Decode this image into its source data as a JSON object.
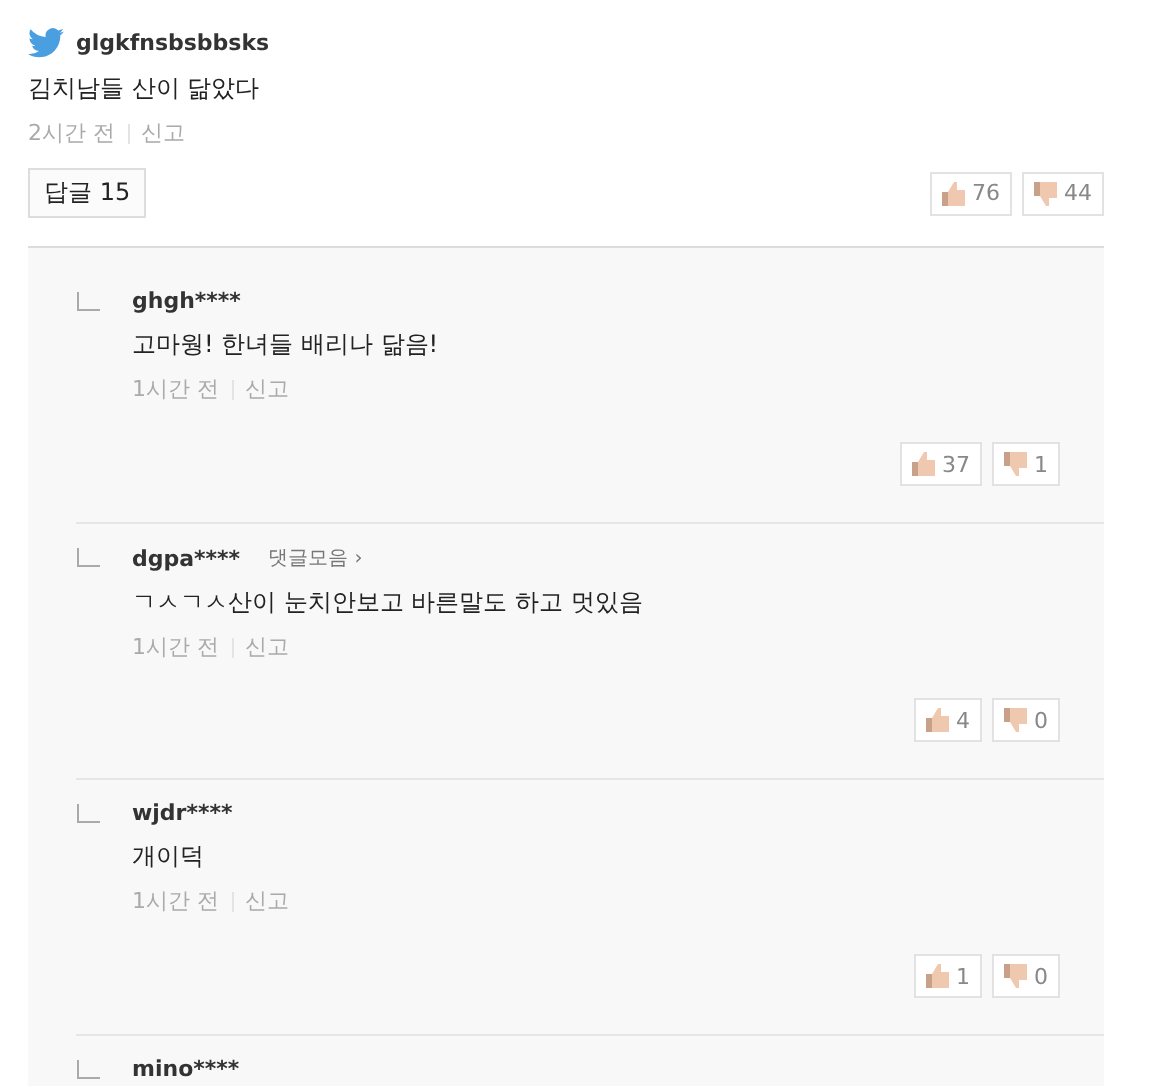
{
  "comment": {
    "author": "glgkfnsbsbbsks",
    "text": "김치남들 산이 닮았다",
    "time": "2시간 전",
    "report": "신고",
    "reply_button": "답글 15",
    "likes": "76",
    "dislikes": "44"
  },
  "replies": [
    {
      "author": "ghgh****",
      "text": "고마웡! 한녀들 배리나 닮음!",
      "time": "1시간 전",
      "report": "신고",
      "likes": "37",
      "dislikes": "1"
    },
    {
      "author": "dgpa****",
      "collection_link": "댓글모음 ›",
      "text": "ㄱㅅㄱㅅ산이 눈치안보고 바른말도 하고 멋있음",
      "time": "1시간 전",
      "report": "신고",
      "likes": "4",
      "dislikes": "0"
    },
    {
      "author": "wjdr****",
      "text": "개이덕",
      "time": "1시간 전",
      "report": "신고",
      "likes": "1",
      "dislikes": "0"
    },
    {
      "author": "mino****"
    }
  ]
}
